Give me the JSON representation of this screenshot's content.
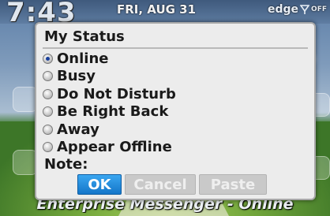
{
  "status_bar": {
    "time": "7:43",
    "date": "FRI, AUG 31",
    "network": "edge",
    "radio_state": "OFF"
  },
  "dialog": {
    "title": "My Status",
    "options": [
      {
        "label": "Online",
        "selected": true
      },
      {
        "label": "Busy",
        "selected": false
      },
      {
        "label": "Do Not Disturb",
        "selected": false
      },
      {
        "label": "Be Right Back",
        "selected": false
      },
      {
        "label": "Away",
        "selected": false
      },
      {
        "label": "Appear Offline",
        "selected": false
      }
    ],
    "note_label": "Note:",
    "buttons": {
      "ok": "OK",
      "cancel": "Cancel",
      "paste": "Paste"
    }
  },
  "background_app_label": "Enterprise Messenger - Online",
  "colors": {
    "ok_button": "#1476c9",
    "dialog_bg": "#ececec",
    "disabled_button": "#c9c9c9"
  }
}
